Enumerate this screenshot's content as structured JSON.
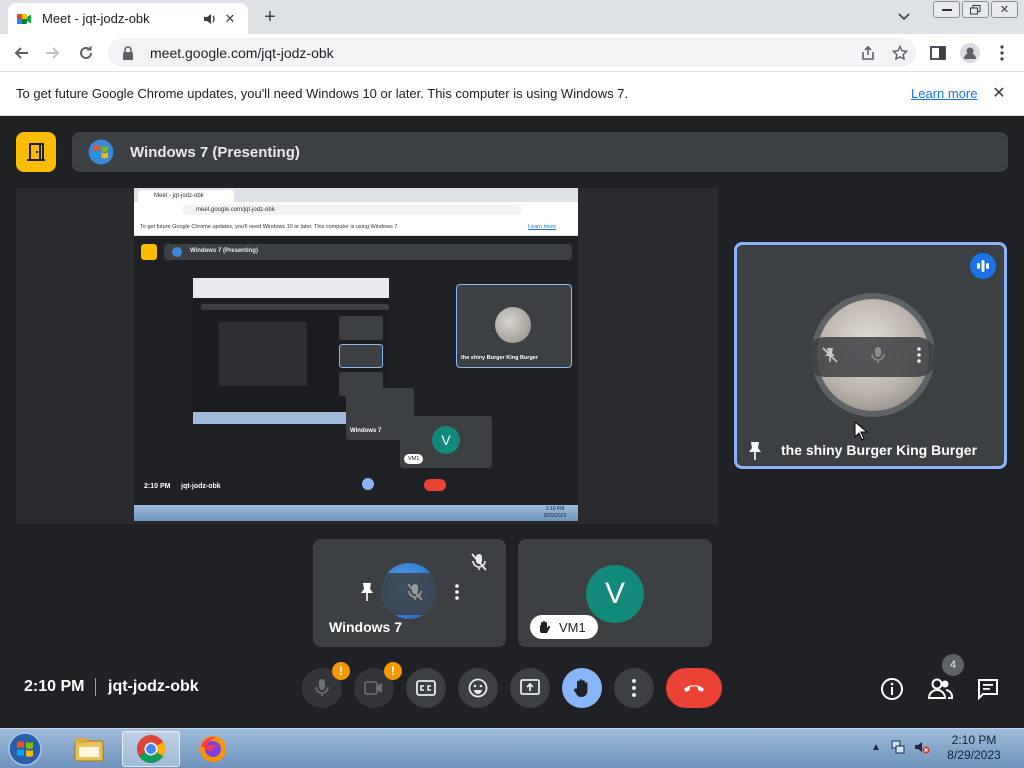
{
  "browser": {
    "tab_title": "Meet - jqt-jodz-obk",
    "new_tab": "+",
    "url": "meet.google.com/jqt-jodz-obk",
    "window_buttons": [
      "minimize",
      "restore",
      "close"
    ]
  },
  "infobar": {
    "message": "To get future Google Chrome updates, you'll need Windows 10 or later. This computer is using Windows 7.",
    "learn_more": "Learn more"
  },
  "meet": {
    "presenting_title": "Windows 7 (Presenting)",
    "presentation_thumb": {
      "tab_title": "Meet - jqt-jodz-obk",
      "url": "meet.google.com/jqt-jodz-obk",
      "infobar": "To get future Google Chrome updates, you'll need Windows 10 or later. This computer is using Windows 7.",
      "learn_more": "Learn more",
      "presenting_title": "Windows 7 (Presenting)",
      "speaker_name": "the shiny Burger King Burger",
      "windows_label": "Windows 7",
      "vm_label": "VM1",
      "vm_initial": "V",
      "clock": "2:10 PM",
      "meeting_code": "jqt-jodz-obk",
      "taskbar_time": "2:10 PM",
      "taskbar_date": "8/29/2023"
    },
    "speaker": {
      "name": "the shiny Burger King Burger"
    },
    "tiles": [
      {
        "name": "Windows 7"
      },
      {
        "name": "VM1",
        "initial": "V",
        "avatar_color": "#128a7a"
      }
    ],
    "clock": "2:10 PM",
    "meeting_code": "jqt-jodz-obk",
    "participant_count": "4",
    "warning_badge": "!"
  },
  "colors": {
    "accent_blue": "#8ab4f8",
    "end_call_red": "#ea4335",
    "warning_orange": "#f29900",
    "exit_yellow": "#fbbc04"
  },
  "taskbar": {
    "time": "2:10 PM",
    "date": "8/29/2023",
    "apps": [
      "explorer-icon",
      "chrome-icon",
      "firefox-icon"
    ]
  }
}
